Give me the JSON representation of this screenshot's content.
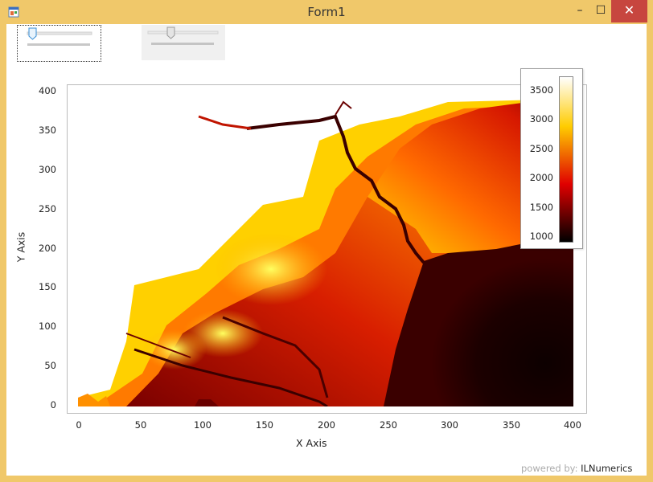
{
  "window": {
    "title": "Form1",
    "minimize_label": "–",
    "maximize_label": "☐",
    "close_label": "✕"
  },
  "sliders": [
    {
      "name": "slider-1",
      "focused": true,
      "enabled": true
    },
    {
      "name": "slider-2",
      "focused": false,
      "enabled": false
    }
  ],
  "chart_data": {
    "type": "heatmap",
    "title": "",
    "xlabel": "X Axis",
    "ylabel": "Y Axis",
    "xlim": [
      0,
      400
    ],
    "ylim": [
      0,
      400
    ],
    "x_ticks": [
      "0",
      "50",
      "100",
      "150",
      "200",
      "250",
      "300",
      "350",
      "400"
    ],
    "y_ticks": [
      "0",
      "50",
      "100",
      "150",
      "200",
      "250",
      "300",
      "350",
      "400"
    ],
    "colormap": "hot",
    "colorbar": {
      "ticks": [
        "1000",
        "1500",
        "2000",
        "2500",
        "3000",
        "3500"
      ],
      "range": [
        950,
        3750
      ],
      "placement": "top-right"
    },
    "grid": true
  },
  "footer": {
    "powered_by": "powered by:",
    "brand": "ILNumerics"
  }
}
